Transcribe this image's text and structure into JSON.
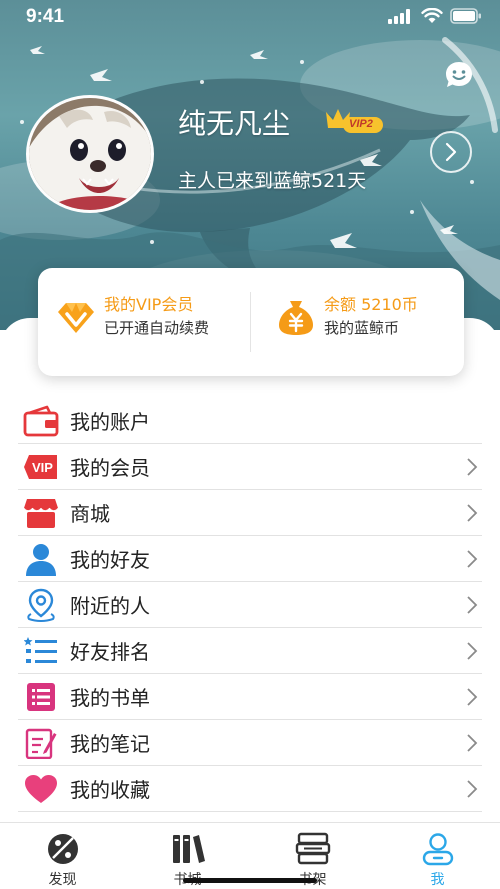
{
  "status_bar": {
    "time": "9:41",
    "icons": [
      "signal-icon",
      "wifi-icon",
      "battery-icon"
    ]
  },
  "profile": {
    "username": "纯无凡尘",
    "vip_level": "VIP2",
    "subtitle": "主人已来到蓝鲸521天",
    "icons": [
      "avatar",
      "crown-icon",
      "chevron-right-circle-icon",
      "chat-smile-icon"
    ]
  },
  "summary_card": {
    "vip": {
      "title": "我的VIP会员",
      "desc": "已开通自动续费",
      "icon": "diamond-icon"
    },
    "balance": {
      "title": "余额 5210币",
      "desc": "我的蓝鲸币",
      "icon": "money-bag-icon"
    }
  },
  "menu": [
    {
      "label": "我的账户",
      "icon": "wallet-icon",
      "chevron": false
    },
    {
      "label": "我的会员",
      "icon": "vip-tag-icon",
      "chevron": true
    },
    {
      "label": "商城",
      "icon": "shop-icon",
      "chevron": true
    },
    {
      "label": "我的好友",
      "icon": "person-icon",
      "chevron": true
    },
    {
      "label": "附近的人",
      "icon": "location-icon",
      "chevron": true
    },
    {
      "label": "好友排名",
      "icon": "ranking-list-icon",
      "chevron": true
    },
    {
      "label": "我的书单",
      "icon": "book-list-icon",
      "chevron": true
    },
    {
      "label": "我的笔记",
      "icon": "note-icon",
      "chevron": true
    },
    {
      "label": "我的收藏",
      "icon": "heart-icon",
      "chevron": true
    }
  ],
  "tabbar": [
    {
      "label": "发现",
      "icon": "discover-icon",
      "active": false
    },
    {
      "label": "书城",
      "icon": "bookstore-icon",
      "active": false
    },
    {
      "label": "书架",
      "icon": "bookshelf-icon",
      "active": false
    },
    {
      "label": "我",
      "icon": "profile-icon",
      "active": true
    }
  ],
  "colors": {
    "accent_orange": "#f59b17",
    "accent_blue": "#2ba7e8",
    "hero_teal": "#5c8f98",
    "icon_red": "#e5383b"
  }
}
